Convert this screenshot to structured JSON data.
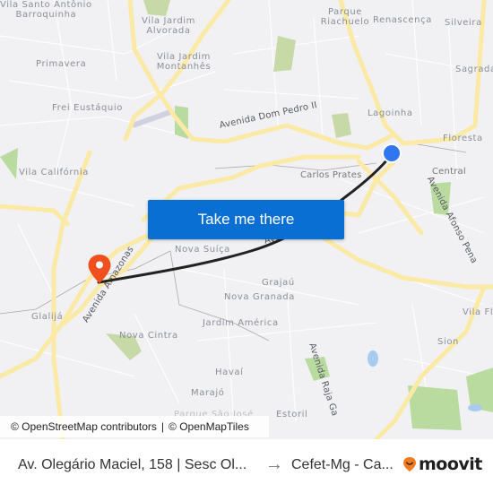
{
  "map": {
    "neighborhoods": [
      {
        "name": "Barroquinha",
        "prefix": "Vila Santo Antônio"
      },
      {
        "name": "Vila Jardim Alvorada"
      },
      {
        "name": "Vila Jardim Montanhês"
      },
      {
        "name": "Primavera"
      },
      {
        "name": "Frei Eustáquio"
      },
      {
        "name": "Parque Riachuelo"
      },
      {
        "name": "Renascença"
      },
      {
        "name": "Silveira"
      },
      {
        "name": "Sagrada"
      },
      {
        "name": "Lagoinha"
      },
      {
        "name": "Floresta"
      },
      {
        "name": "Central"
      },
      {
        "name": "Carlos Prates"
      },
      {
        "name": "Vila Califórnia"
      },
      {
        "name": "Nova Suíça"
      },
      {
        "name": "Grajaú"
      },
      {
        "name": "Nova Granada"
      },
      {
        "name": "Jardim América"
      },
      {
        "name": "Glalijá"
      },
      {
        "name": "Nova Cintra"
      },
      {
        "name": "Havaí"
      },
      {
        "name": "Marajó"
      },
      {
        "name": "Estoril"
      },
      {
        "name": "Parque São José"
      },
      {
        "name": "Vila Fl"
      },
      {
        "name": "Sion"
      }
    ],
    "roads": {
      "dom_pedro": "Avenida Dom Pedro II",
      "afonso_pena": "Avenida Afonso Pena",
      "amazonas": "Avenida Amazonas",
      "raja": "Avenida Raja Ga",
      "avenida": "Avenida"
    },
    "origin_marker": "origin-dot",
    "destination_marker": "destination-pin",
    "colors": {
      "route": "#222222",
      "origin": "#2f76f0",
      "destination": "#f0501e",
      "button": "#0a6fd2",
      "major_road": "#fbe9a6",
      "park": "#c8d9a8"
    }
  },
  "cta": {
    "label": "Take me there"
  },
  "attribution": {
    "osm": "© OpenStreetMap contributors",
    "separator": "|",
    "omt": "© OpenMapTiles"
  },
  "footer": {
    "from": "Av. Olegário Maciel, 158 | Sesc Ol...",
    "arrow": "→",
    "to": "Cefet-Mg - Ca...",
    "brand": "moovit"
  }
}
